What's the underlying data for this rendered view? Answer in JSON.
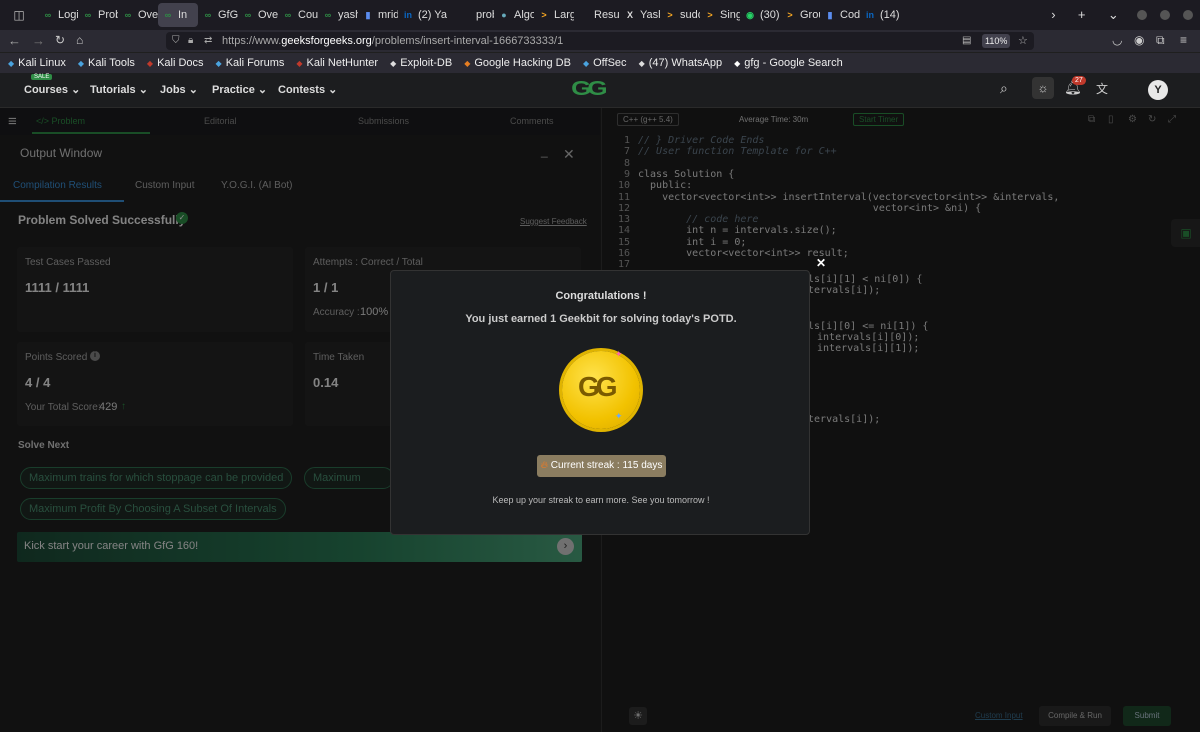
{
  "browser": {
    "tabs": [
      {
        "label": "Logi",
        "icon": "gfg-icon"
      },
      {
        "label": "Prob",
        "icon": "gfg-icon"
      },
      {
        "label": "Over",
        "icon": "gfg-icon"
      },
      {
        "label": "In",
        "icon": "gfg-icon",
        "active": true
      },
      {
        "label": "GfG",
        "icon": "gfg-icon"
      },
      {
        "label": "Over",
        "icon": "gfg-icon"
      },
      {
        "label": "Cour",
        "icon": "gfg-icon"
      },
      {
        "label": "yash",
        "icon": "gfg-icon"
      },
      {
        "label": "mrid",
        "icon": "chart-icon"
      },
      {
        "label": "(2) Ya",
        "icon": "linkedin-icon"
      },
      {
        "label": "problem",
        "icon": "none"
      },
      {
        "label": "Algo",
        "icon": "globe-icon"
      },
      {
        "label": "Larg",
        "icon": "bracket-icon"
      },
      {
        "label": "Resume",
        "icon": "none"
      },
      {
        "label": "Yash",
        "icon": "x-icon"
      },
      {
        "label": "sudo",
        "icon": "bracket-icon"
      },
      {
        "label": "Singl",
        "icon": "bracket-icon"
      },
      {
        "label": "(30)",
        "icon": "whatsapp-icon"
      },
      {
        "label": "Grou",
        "icon": "bracket-icon"
      },
      {
        "label": "Code",
        "icon": "chart-icon"
      },
      {
        "label": "(14)",
        "icon": "linkedin-icon"
      }
    ],
    "url_prefix": "https://www.",
    "url_domain": "geeksforgeeks.org",
    "url_path": "/problems/insert-interval-1666733333/1",
    "zoom": "110%",
    "bookmarks": [
      "Kali Linux",
      "Kali Tools",
      "Kali Docs",
      "Kali Forums",
      "Kali NetHunter",
      "Exploit-DB",
      "Google Hacking DB",
      "OffSec",
      "(47) WhatsApp",
      "gfg - Google Search"
    ]
  },
  "site": {
    "sale_badge": "SALE",
    "nav": [
      "Courses",
      "Tutorials",
      "Jobs",
      "Practice",
      "Contests"
    ],
    "logo": "GG",
    "notification_count": "27",
    "avatar_letter": "Y"
  },
  "left": {
    "tabs": [
      "</> Problem",
      "Editorial",
      "Submissions",
      "Comments"
    ],
    "output_title": "Output Window",
    "result_tabs": [
      "Compilation Results",
      "Custom Input",
      "Y.O.G.I. (AI Bot)"
    ],
    "status": "Problem Solved Successfully",
    "suggest_feedback": "Suggest Feedback",
    "test_cases_label": "Test Cases Passed",
    "test_cases_value": "1111 / 1111",
    "attempts_label": "Attempts : Correct / Total",
    "attempts_value": "1 / 1",
    "accuracy_label": "Accuracy :",
    "accuracy_value": "100%",
    "points_label": "Points Scored",
    "points_value": "4 / 4",
    "total_score_label": "Your Total Score:",
    "total_score_value": "429",
    "time_label": "Time Taken",
    "time_value": "0.14",
    "solve_next_title": "Solve Next",
    "solve_next": [
      "Maximum trains for which stoppage can be provided",
      "Maximum Frequ",
      "Maximum Profit By Choosing A Subset Of Intervals"
    ],
    "banner": "Kick start your career with GfG 160!"
  },
  "right": {
    "language": "C++ (g++ 5.4)",
    "avg_time": "Average Time: 30m",
    "start_timer": "Start Timer",
    "custom_input": "Custom Input",
    "compile_run": "Compile & Run",
    "submit": "Submit"
  },
  "code": {
    "lines": [
      {
        "n": "1",
        "t": "// } Driver Code Ends",
        "cls": "cm"
      },
      {
        "n": "7",
        "t": "// User function Template for C++",
        "cls": "cm"
      },
      {
        "n": "8",
        "t": ""
      },
      {
        "n": "9",
        "t": "class Solution {"
      },
      {
        "n": "10",
        "t": "  public:"
      },
      {
        "n": "11",
        "t": "    vector<vector<int>> insertInterval(vector<vector<int>> &intervals,"
      },
      {
        "n": "12",
        "t": "                                       vector<int> &ni) {"
      },
      {
        "n": "13",
        "t": "        // code here",
        "cls": "cm"
      },
      {
        "n": "14",
        "t": "        int n = intervals.size();"
      },
      {
        "n": "15",
        "t": "        int i = 0;"
      },
      {
        "n": "16",
        "t": "        vector<vector<int>> result;"
      },
      {
        "n": "17",
        "t": ""
      }
    ],
    "hidden_fragments": [
      "als[i][1] < ni[0]) {",
      "ntervals[i]);",
      "als[i][0] <= ni[1]) {",
      " intervals[i][0]);",
      " intervals[i][1]);",
      "ntervals[i]);"
    ]
  },
  "modal": {
    "title": "Congratulations !",
    "message": "You just earned 1 Geekbit for solving today's POTD.",
    "coin_logo": "GG",
    "streak": "Current streak : 115 days",
    "footer": "Keep up your streak to earn more. See you tomorrow !"
  },
  "colors": {
    "accent": "#2f8d46",
    "background": "#1f1f1f",
    "link": "#3a8fd6"
  }
}
